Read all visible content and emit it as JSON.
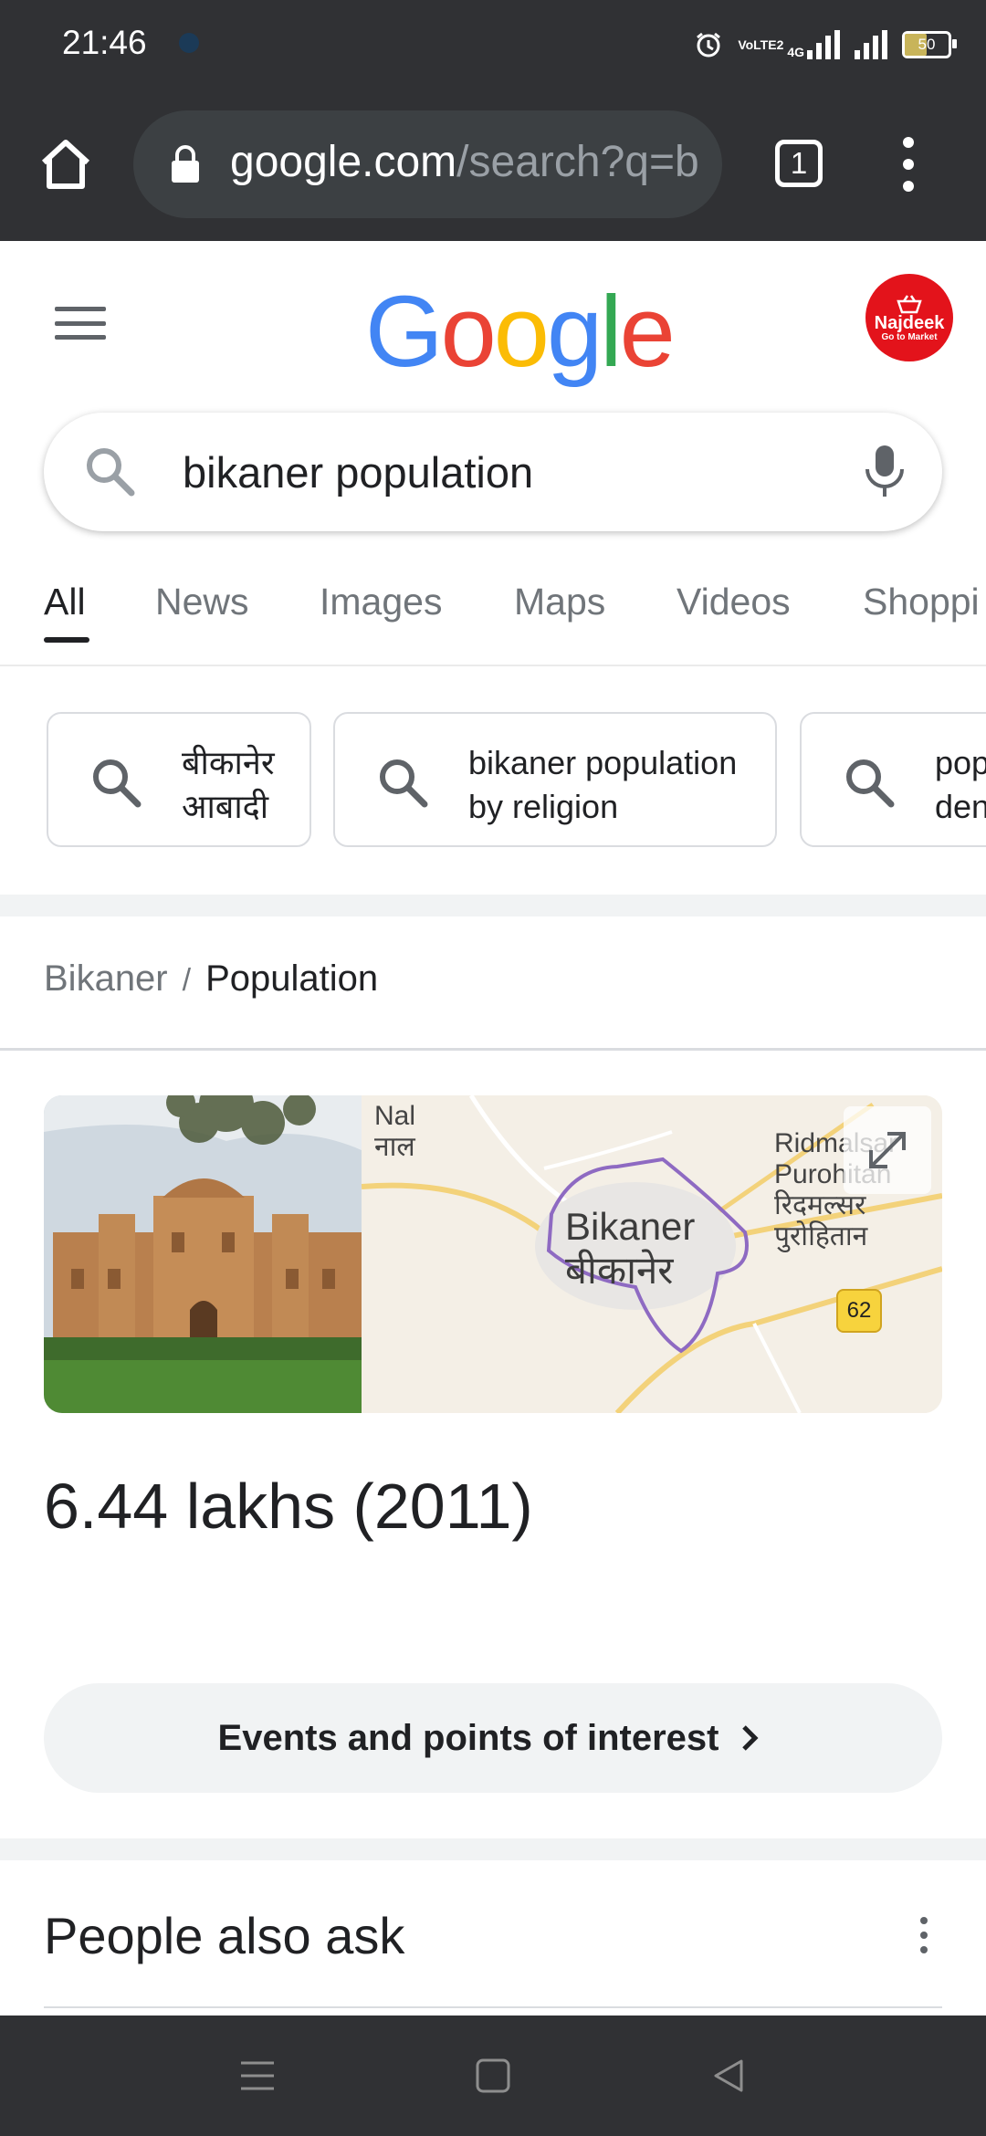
{
  "status_bar": {
    "time": "21:46",
    "battery": "50",
    "volte": "VoLTE2",
    "network": "4G"
  },
  "browser": {
    "url_host": "google.com",
    "url_path": "/search?q=b",
    "tab_count": "1"
  },
  "google": {
    "logo": "Google",
    "avatar_line1": "Najdeek",
    "avatar_line2": "Go to Market"
  },
  "search": {
    "query": "bikaner population"
  },
  "tabs": [
    {
      "label": "All",
      "active": true
    },
    {
      "label": "News"
    },
    {
      "label": "Images"
    },
    {
      "label": "Maps"
    },
    {
      "label": "Videos"
    },
    {
      "label": "Shoppi"
    }
  ],
  "chips": [
    {
      "line1": "बीकानेर",
      "line2": "आबादी"
    },
    {
      "line1": "bikaner population",
      "line2": "by religion"
    },
    {
      "line1": "pop",
      "line2": "den"
    }
  ],
  "breadcrumb": {
    "parent": "Bikaner",
    "separator": "/",
    "current": "Population"
  },
  "map": {
    "label_nal_en": "Nal",
    "label_nal_hi": "नाल",
    "label_bikaner_en": "Bikaner",
    "label_bikaner_hi": "बीकानेर",
    "label_ridm_en1": "Ridmalsar",
    "label_ridm_en2": "Purohitan",
    "label_ridm_hi1": "रिदमल्सर",
    "label_ridm_hi2": "पुरोहितान",
    "highway": "62"
  },
  "answer": {
    "value": "6.44 lakhs (2011)"
  },
  "events_button": {
    "label": "Events and points of interest"
  },
  "paa": {
    "title": "People also ask"
  },
  "colors": {
    "g_blue": "#4285F4",
    "g_red": "#EA4335",
    "g_yellow": "#FBBC05",
    "g_green": "#34A853",
    "chrome_dark": "#303134"
  }
}
